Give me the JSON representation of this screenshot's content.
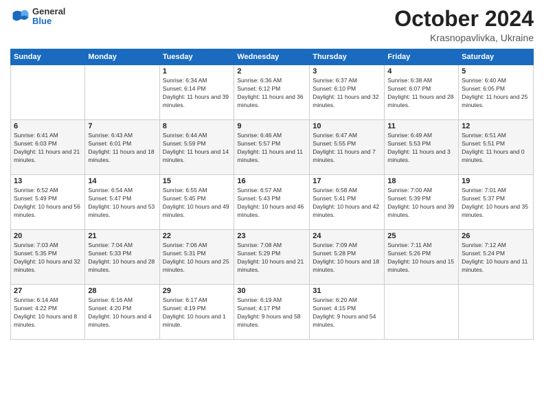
{
  "header": {
    "logo": {
      "general": "General",
      "blue": "Blue"
    },
    "title": "October 2024",
    "location": "Krasnopavlivka, Ukraine"
  },
  "days_of_week": [
    "Sunday",
    "Monday",
    "Tuesday",
    "Wednesday",
    "Thursday",
    "Friday",
    "Saturday"
  ],
  "weeks": [
    [
      {
        "day": "",
        "info": ""
      },
      {
        "day": "",
        "info": ""
      },
      {
        "day": "1",
        "info": "Sunrise: 6:34 AM\nSunset: 6:14 PM\nDaylight: 11 hours and 39 minutes."
      },
      {
        "day": "2",
        "info": "Sunrise: 6:36 AM\nSunset: 6:12 PM\nDaylight: 11 hours and 36 minutes."
      },
      {
        "day": "3",
        "info": "Sunrise: 6:37 AM\nSunset: 6:10 PM\nDaylight: 11 hours and 32 minutes."
      },
      {
        "day": "4",
        "info": "Sunrise: 6:38 AM\nSunset: 6:07 PM\nDaylight: 11 hours and 28 minutes."
      },
      {
        "day": "5",
        "info": "Sunrise: 6:40 AM\nSunset: 6:05 PM\nDaylight: 11 hours and 25 minutes."
      }
    ],
    [
      {
        "day": "6",
        "info": "Sunrise: 6:41 AM\nSunset: 6:03 PM\nDaylight: 11 hours and 21 minutes."
      },
      {
        "day": "7",
        "info": "Sunrise: 6:43 AM\nSunset: 6:01 PM\nDaylight: 11 hours and 18 minutes."
      },
      {
        "day": "8",
        "info": "Sunrise: 6:44 AM\nSunset: 5:59 PM\nDaylight: 11 hours and 14 minutes."
      },
      {
        "day": "9",
        "info": "Sunrise: 6:46 AM\nSunset: 5:57 PM\nDaylight: 11 hours and 11 minutes."
      },
      {
        "day": "10",
        "info": "Sunrise: 6:47 AM\nSunset: 5:55 PM\nDaylight: 11 hours and 7 minutes."
      },
      {
        "day": "11",
        "info": "Sunrise: 6:49 AM\nSunset: 5:53 PM\nDaylight: 11 hours and 3 minutes."
      },
      {
        "day": "12",
        "info": "Sunrise: 6:51 AM\nSunset: 5:51 PM\nDaylight: 11 hours and 0 minutes."
      }
    ],
    [
      {
        "day": "13",
        "info": "Sunrise: 6:52 AM\nSunset: 5:49 PM\nDaylight: 10 hours and 56 minutes."
      },
      {
        "day": "14",
        "info": "Sunrise: 6:54 AM\nSunset: 5:47 PM\nDaylight: 10 hours and 53 minutes."
      },
      {
        "day": "15",
        "info": "Sunrise: 6:55 AM\nSunset: 5:45 PM\nDaylight: 10 hours and 49 minutes."
      },
      {
        "day": "16",
        "info": "Sunrise: 6:57 AM\nSunset: 5:43 PM\nDaylight: 10 hours and 46 minutes."
      },
      {
        "day": "17",
        "info": "Sunrise: 6:58 AM\nSunset: 5:41 PM\nDaylight: 10 hours and 42 minutes."
      },
      {
        "day": "18",
        "info": "Sunrise: 7:00 AM\nSunset: 5:39 PM\nDaylight: 10 hours and 39 minutes."
      },
      {
        "day": "19",
        "info": "Sunrise: 7:01 AM\nSunset: 5:37 PM\nDaylight: 10 hours and 35 minutes."
      }
    ],
    [
      {
        "day": "20",
        "info": "Sunrise: 7:03 AM\nSunset: 5:35 PM\nDaylight: 10 hours and 32 minutes."
      },
      {
        "day": "21",
        "info": "Sunrise: 7:04 AM\nSunset: 5:33 PM\nDaylight: 10 hours and 28 minutes."
      },
      {
        "day": "22",
        "info": "Sunrise: 7:06 AM\nSunset: 5:31 PM\nDaylight: 10 hours and 25 minutes."
      },
      {
        "day": "23",
        "info": "Sunrise: 7:08 AM\nSunset: 5:29 PM\nDaylight: 10 hours and 21 minutes."
      },
      {
        "day": "24",
        "info": "Sunrise: 7:09 AM\nSunset: 5:28 PM\nDaylight: 10 hours and 18 minutes."
      },
      {
        "day": "25",
        "info": "Sunrise: 7:11 AM\nSunset: 5:26 PM\nDaylight: 10 hours and 15 minutes."
      },
      {
        "day": "26",
        "info": "Sunrise: 7:12 AM\nSunset: 5:24 PM\nDaylight: 10 hours and 11 minutes."
      }
    ],
    [
      {
        "day": "27",
        "info": "Sunrise: 6:14 AM\nSunset: 4:22 PM\nDaylight: 10 hours and 8 minutes."
      },
      {
        "day": "28",
        "info": "Sunrise: 6:16 AM\nSunset: 4:20 PM\nDaylight: 10 hours and 4 minutes."
      },
      {
        "day": "29",
        "info": "Sunrise: 6:17 AM\nSunset: 4:19 PM\nDaylight: 10 hours and 1 minute."
      },
      {
        "day": "30",
        "info": "Sunrise: 6:19 AM\nSunset: 4:17 PM\nDaylight: 9 hours and 58 minutes."
      },
      {
        "day": "31",
        "info": "Sunrise: 6:20 AM\nSunset: 4:15 PM\nDaylight: 9 hours and 54 minutes."
      },
      {
        "day": "",
        "info": ""
      },
      {
        "day": "",
        "info": ""
      }
    ]
  ]
}
